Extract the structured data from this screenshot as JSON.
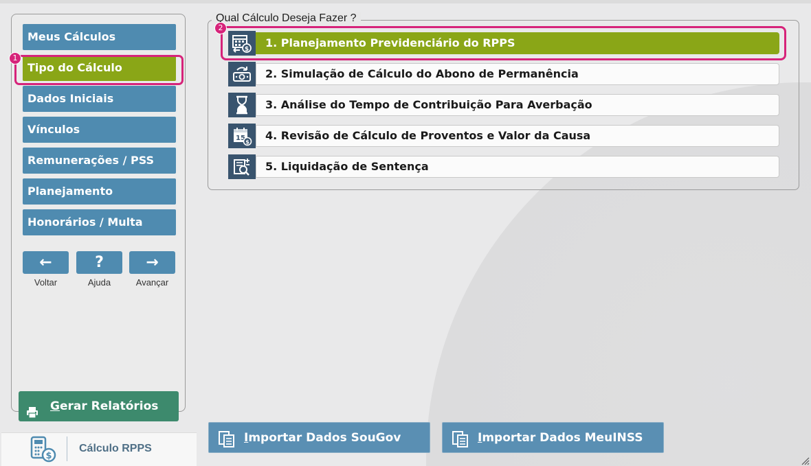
{
  "sidebar": {
    "items": [
      {
        "label": "Meus Cálculos"
      },
      {
        "label": "Tipo do Cálculo",
        "active": true
      },
      {
        "label": "Dados Iniciais"
      },
      {
        "label": "Vínculos"
      },
      {
        "label": "Remunerações / PSS"
      },
      {
        "label": "Planejamento"
      },
      {
        "label": "Honorários / Multa"
      }
    ],
    "nav": {
      "back_glyph": "←",
      "back_label": "Voltar",
      "help_glyph": "?",
      "help_label": "Ajuda",
      "next_glyph": "→",
      "next_label": "Avançar"
    },
    "report_button": {
      "accel": "G",
      "rest": "erar Relatórios"
    }
  },
  "badges": {
    "one": "1",
    "two": "2"
  },
  "brand": {
    "name": "Cálculo RPPS"
  },
  "main": {
    "group_title": "Qual Cálculo Deseja Fazer ?",
    "options": [
      {
        "label": "1. Planejamento Previdenciário do RPPS",
        "icon": "calendar-money-icon",
        "active": true
      },
      {
        "label": "2. Simulação de Cálculo do Abono de Permanência",
        "icon": "money-cycle-icon"
      },
      {
        "label": "3. Análise do Tempo de Contribuição Para Averbação",
        "icon": "hourglass-icon"
      },
      {
        "label": "4. Revisão de Cálculo de Proventos e Valor da Causa",
        "icon": "calendar-15-icon"
      },
      {
        "label": "5. Liquidação de Sentença",
        "icon": "document-search-icon"
      }
    ]
  },
  "imports": {
    "sougov": {
      "accel": "I",
      "rest": "mportar Dados SouGov"
    },
    "meuinss": {
      "accel": "I",
      "rest": "mportar Dados MeuINSS"
    }
  },
  "colors": {
    "nav_blue": "#4f8bb0",
    "active_green": "#8aa617",
    "report_green": "#3d8a6d",
    "highlight_pink": "#d6237a",
    "icon_navy": "#39546e"
  }
}
